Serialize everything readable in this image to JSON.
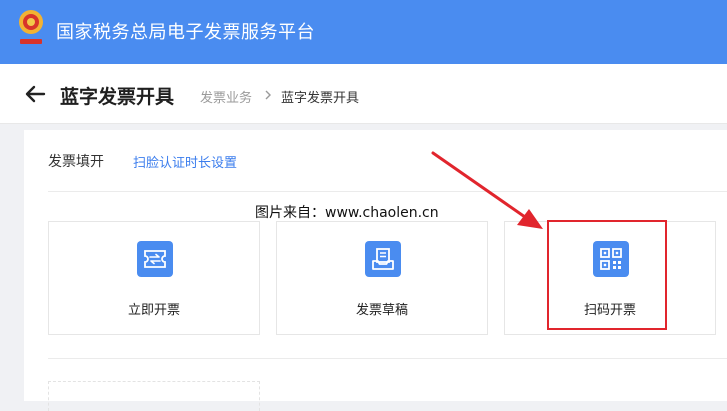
{
  "app": {
    "title": "国家税务总局电子发票服务平台"
  },
  "header": {
    "page_title": "蓝字发票开具",
    "breadcrumb": [
      "发票业务",
      "蓝字发票开具"
    ]
  },
  "section": {
    "title": "发票填开",
    "link": "扫脸认证时长设置"
  },
  "watermark": "图片来自：www.chaolen.cn",
  "cards": [
    {
      "label": "立即开票",
      "icon": "ticket-exchange-icon"
    },
    {
      "label": "发票草稿",
      "icon": "draft-tray-icon"
    },
    {
      "label": "扫码开票",
      "icon": "qr-code-icon"
    }
  ],
  "colors": {
    "brand": "#4a8cf0",
    "highlight": "#e1252d",
    "link": "#3b7ded"
  }
}
